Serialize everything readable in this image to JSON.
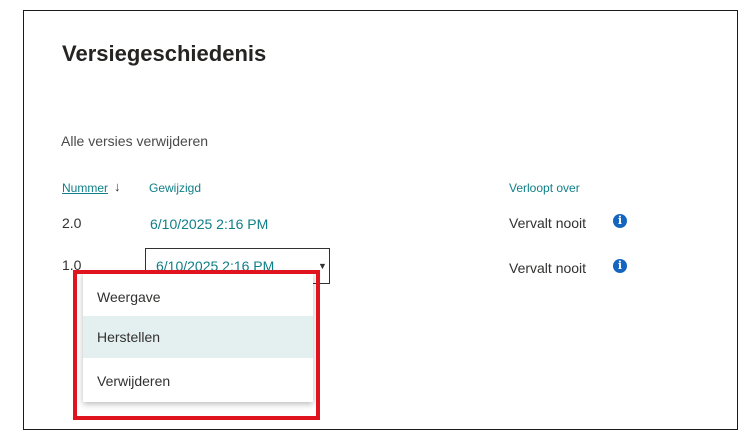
{
  "dialog": {
    "title": "Versiegeschiedenis",
    "delete_all": "Alle versies verwijderen"
  },
  "table": {
    "headers": {
      "number": "Nummer",
      "sort_arrow": "↓",
      "modified": "Gewijzigd",
      "expires": "Verloopt over"
    },
    "rows": [
      {
        "number": "2.0",
        "modified": "6/10/2025 2:16 PM",
        "expires": "Vervalt nooit"
      },
      {
        "number": "1.0",
        "modified": "6/10/2025 2:16 PM",
        "expires": "Vervalt nooit"
      }
    ]
  },
  "context_menu": {
    "items": [
      {
        "label": "Weergave"
      },
      {
        "label": "Herstellen",
        "hovered": true
      },
      {
        "label": "Verwijderen"
      }
    ]
  },
  "icons": {
    "info": "info-icon",
    "dropdown": "chevron-down-icon"
  },
  "colors": {
    "link": "#0f7f88",
    "highlight": "#e0141e",
    "hover": "#e4f0f0",
    "info_icon": "#1565c0"
  }
}
